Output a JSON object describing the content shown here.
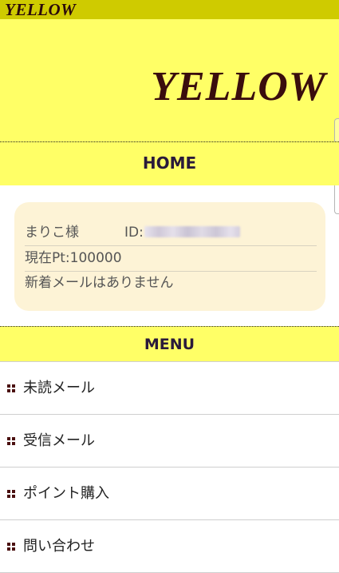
{
  "header": {
    "small_logo": "YELLOW",
    "banner_logo": "YELLOW"
  },
  "home": {
    "title": "HOME",
    "user_name": "まりこ様",
    "id_label": "ID:",
    "points": "現在Pt:100000",
    "mail_status": "新着メールはありません"
  },
  "menu": {
    "title": "MENU",
    "items": [
      {
        "label": "未読メール",
        "icon": "grid-bullet-icon"
      },
      {
        "label": "受信メール",
        "icon": "grid-bullet-icon"
      },
      {
        "label": "ポイント購入",
        "icon": "grid-bullet-icon"
      },
      {
        "label": "問い合わせ",
        "icon": "grid-bullet-icon"
      }
    ]
  },
  "colors": {
    "topbar": "#cfcb00",
    "banner": "#ffff66",
    "card": "#fdf3d6",
    "logo_text": "#3a0d0d",
    "bullet": "#4a1010"
  }
}
